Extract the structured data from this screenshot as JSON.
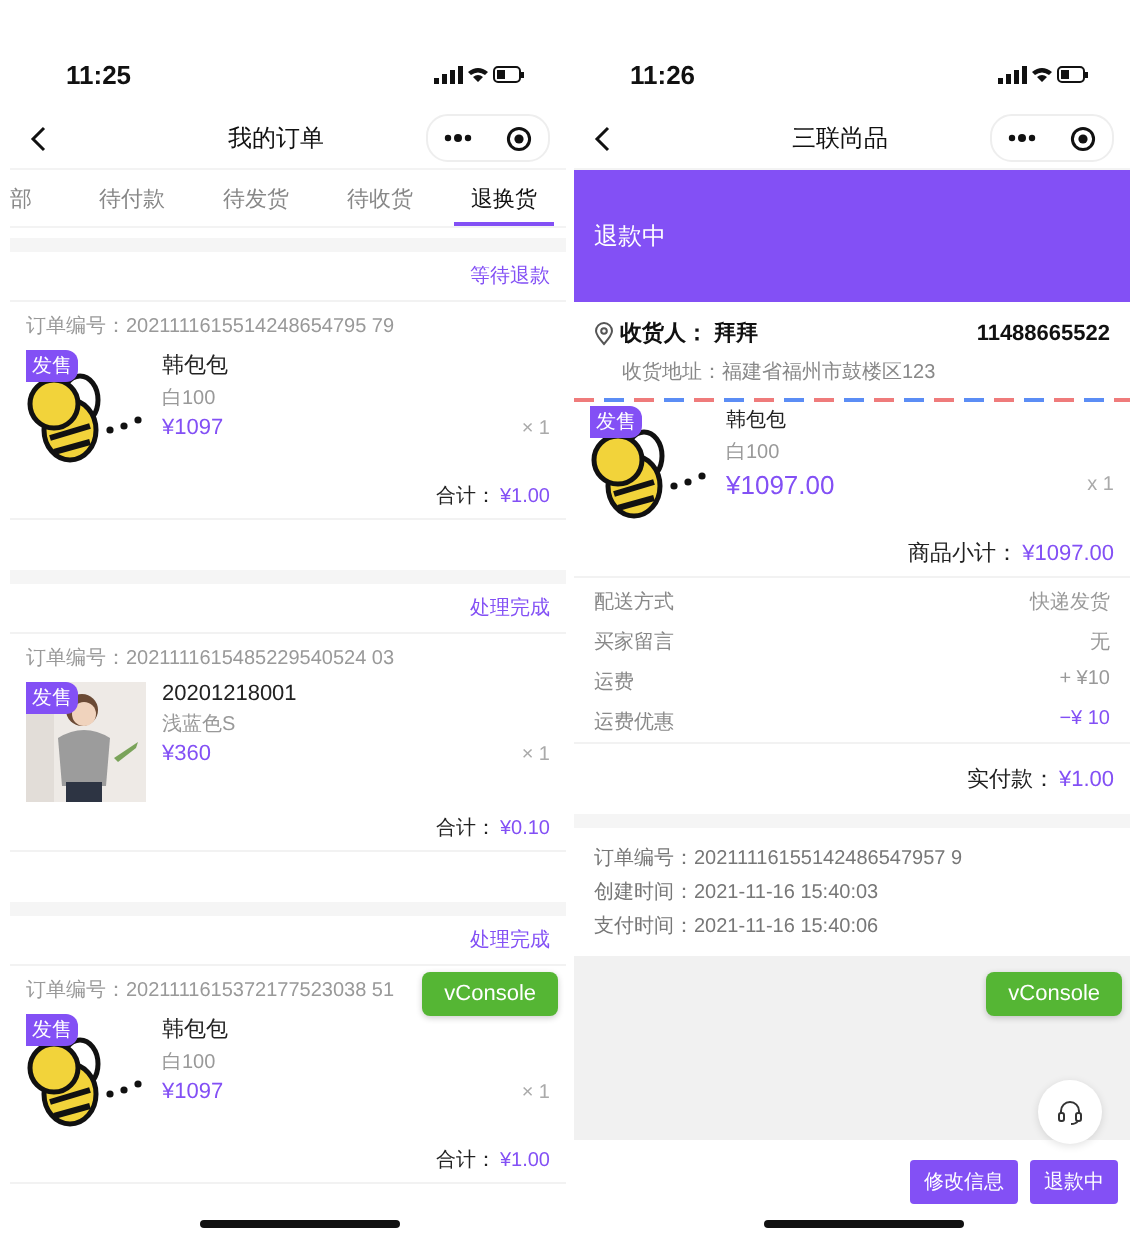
{
  "left_screen": {
    "status_bar": {
      "time": "11:25"
    },
    "title": "我的订单",
    "tabs": [
      {
        "label": "部",
        "selected": false
      },
      {
        "label": "待付款",
        "selected": false
      },
      {
        "label": "待发货",
        "selected": false
      },
      {
        "label": "待收货",
        "selected": false
      },
      {
        "label": "退换货",
        "selected": true
      }
    ],
    "orders": [
      {
        "status": "等待退款",
        "order_no_label": "订单编号：",
        "order_no": "2021111615514248654795 79",
        "tag": "发售",
        "name": "韩包包",
        "spec": "白100",
        "price": "¥1097",
        "quantity": "× 1",
        "total_label": "合计：",
        "total": "¥1.00"
      },
      {
        "status": "处理完成",
        "order_no_label": "订单编号：",
        "order_no": "2021111615485229540524 03",
        "tag": "发售",
        "name": "20201218001",
        "spec": "浅蓝色S",
        "price": "¥360",
        "quantity": "× 1",
        "total_label": "合计：",
        "total": "¥0.10"
      },
      {
        "status": "处理完成",
        "order_no_label": "订单编号：",
        "order_no": "2021111615372177523038 51",
        "tag": "发售",
        "name": "韩包包",
        "spec": "白100",
        "price": "¥1097",
        "quantity": "× 1",
        "total_label": "合计：",
        "total": "¥1.00"
      }
    ],
    "floating_button": "vConsole"
  },
  "right_screen": {
    "status_bar": {
      "time": "11:26"
    },
    "title": "三联尚品",
    "banner": "退款中",
    "address": {
      "recipient_label": "收货人：",
      "recipient": "拜拜",
      "phone": "11488665522",
      "address_label": "收货地址：",
      "address": "福建省福州市鼓楼区123"
    },
    "product": {
      "tag": "发售",
      "name": "韩包包",
      "spec": "白100",
      "price": "¥1097.00",
      "quantity": "x 1"
    },
    "subtotal_label": "商品小计：",
    "subtotal": "¥1097.00",
    "details": [
      {
        "label": "配送方式",
        "value": "快递发货",
        "highlight": false
      },
      {
        "label": "买家留言",
        "value": "无",
        "highlight": false
      },
      {
        "label": "运费",
        "value": "+ ¥10",
        "highlight": false
      },
      {
        "label": "运费优惠",
        "value": "−¥ 10",
        "highlight": true
      }
    ],
    "paid_label": "实付款：",
    "paid": "¥1.00",
    "info": [
      {
        "label": "订单编号：",
        "value": "20211116155142486547957 9"
      },
      {
        "label": "创建时间：",
        "value": "2021-11-16 15:40:03"
      },
      {
        "label": "支付时间：",
        "value": "2021-11-16 15:40:06"
      }
    ],
    "floating_button": "vConsole",
    "buttons": [
      "修改信息",
      "退款中"
    ]
  }
}
